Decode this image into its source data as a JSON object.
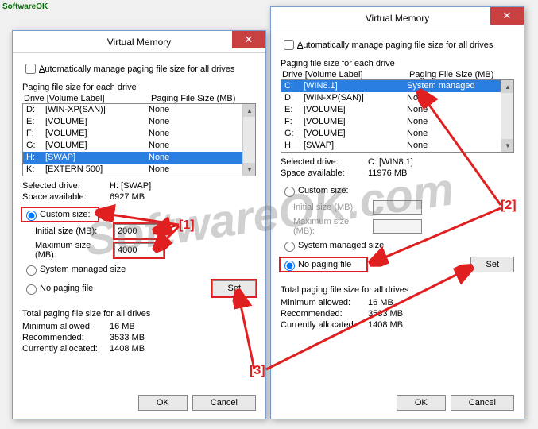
{
  "watermark": "SoftwareOK.com",
  "window_title": "Virtual Memory",
  "auto_manage_label": "Automatically manage paging file size for all drives",
  "group_each_drive": "Paging file size for each drive",
  "header_drive": "Drive  [Volume Label]",
  "header_size": "Paging File Size (MB)",
  "left": {
    "drives": [
      {
        "d": "D:",
        "l": "[WIN-XP(SAN)]",
        "s": "None",
        "sel": false
      },
      {
        "d": "E:",
        "l": "[VOLUME]",
        "s": "None",
        "sel": false
      },
      {
        "d": "F:",
        "l": "[VOLUME]",
        "s": "None",
        "sel": false
      },
      {
        "d": "G:",
        "l": "[VOLUME]",
        "s": "None",
        "sel": false
      },
      {
        "d": "H:",
        "l": "[SWAP]",
        "s": "None",
        "sel": true
      },
      {
        "d": "K:",
        "l": "[EXTERN 500]",
        "s": "None",
        "sel": false
      }
    ],
    "selected_drive": "H:  [SWAP]",
    "space_available": "6927 MB",
    "custom_size_checked": true,
    "initial_size": "2000",
    "max_size": "4000",
    "system_managed_checked": false,
    "no_paging_checked": false,
    "min_allowed": "16 MB",
    "recommended": "3533 MB",
    "current_allocated": "1408 MB"
  },
  "right": {
    "drives": [
      {
        "d": "C:",
        "l": "[WIN8.1]",
        "s": "System managed",
        "sel": true
      },
      {
        "d": "D:",
        "l": "[WIN-XP(SAN)]",
        "s": "None",
        "sel": false
      },
      {
        "d": "E:",
        "l": "[VOLUME]",
        "s": "None",
        "sel": false
      },
      {
        "d": "F:",
        "l": "[VOLUME]",
        "s": "None",
        "sel": false
      },
      {
        "d": "G:",
        "l": "[VOLUME]",
        "s": "None",
        "sel": false
      },
      {
        "d": "H:",
        "l": "[SWAP]",
        "s": "None",
        "sel": false
      }
    ],
    "selected_drive": "C:  [WIN8.1]",
    "space_available": "11976 MB",
    "custom_size_checked": false,
    "initial_size": "",
    "max_size": "",
    "system_managed_checked": false,
    "no_paging_checked": true,
    "min_allowed": "16 MB",
    "recommended": "3533 MB",
    "current_allocated": "1408 MB"
  },
  "labels": {
    "selected_drive": "Selected drive:",
    "space_available": "Space available:",
    "custom_size": "Custom size:",
    "initial_size": "Initial size (MB):",
    "max_size": "Maximum size (MB):",
    "system_managed": "System managed size",
    "no_paging": "No paging file",
    "set": "Set",
    "total_group": "Total paging file size for all drives",
    "min_allowed": "Minimum allowed:",
    "recommended": "Recommended:",
    "current_alloc": "Currently allocated:",
    "ok": "OK",
    "cancel": "Cancel"
  },
  "annotations": {
    "a1": "[1]",
    "a2": "[2]",
    "a3": "[3]"
  }
}
